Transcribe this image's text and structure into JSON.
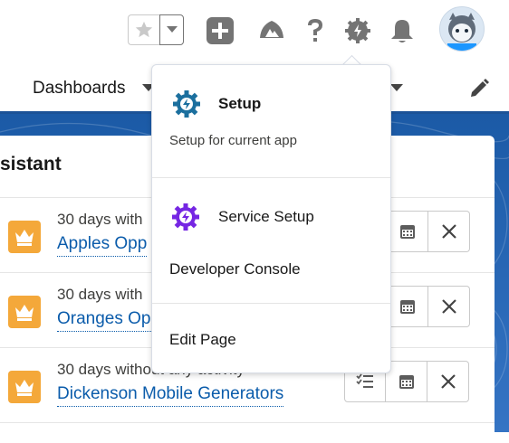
{
  "header": {
    "favorites_icon": "star-icon",
    "favorites_menu_icon": "chevron-down-icon",
    "actions": [
      {
        "name": "global-actions",
        "icon": "add-icon"
      },
      {
        "name": "trailhead",
        "icon": "trailhead-icon"
      },
      {
        "name": "help",
        "icon": "help-icon"
      },
      {
        "name": "setup",
        "icon": "gear-icon"
      },
      {
        "name": "notifications",
        "icon": "bell-icon"
      }
    ],
    "avatar_icon": "astro-avatar"
  },
  "nav": {
    "dashboards_label": "Dashboards",
    "edit_icon": "pencil-icon"
  },
  "card": {
    "title_partial": "sistant",
    "rows": [
      {
        "subtitle": "30 days with",
        "link": "Apples Opp"
      },
      {
        "subtitle": "30 days with",
        "link": "Oranges Op"
      },
      {
        "subtitle": "30 days without any activity",
        "link": "Dickenson Mobile Generators"
      }
    ]
  },
  "setup_menu": {
    "setup": {
      "label": "Setup",
      "description": "Setup for current app",
      "icon": "setup-gear-icon"
    },
    "service_setup": {
      "label": "Service Setup",
      "icon": "service-setup-gear-icon"
    },
    "developer_console": {
      "label": "Developer Console"
    },
    "edit_page": {
      "label": "Edit Page"
    }
  },
  "colors": {
    "brand_blue": "#1b5297",
    "link_blue": "#0b5cab",
    "setup_teal": "#1b6f9e",
    "service_purple": "#7526e3",
    "crown_orange": "#f4a83a",
    "header_icon_grey": "#747474"
  }
}
